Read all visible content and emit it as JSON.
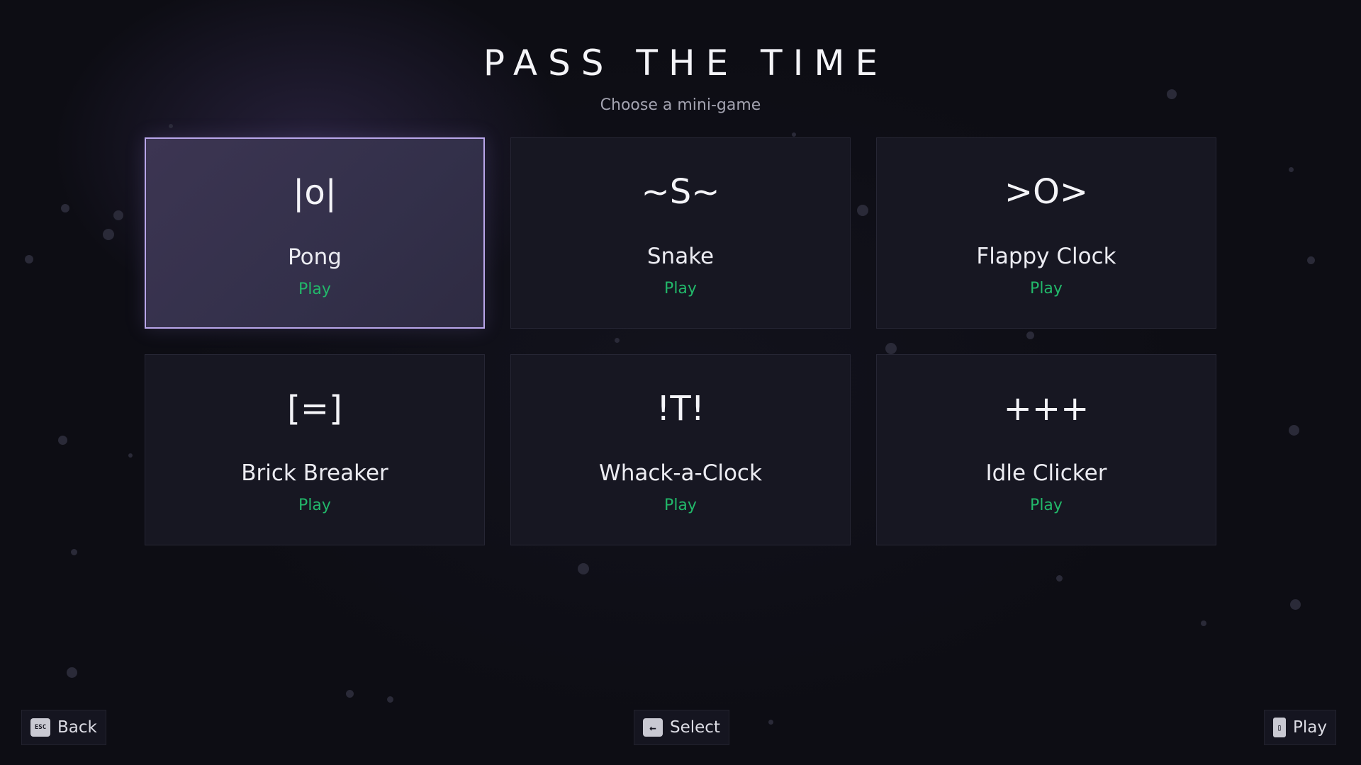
{
  "header": {
    "title": "PASS THE TIME",
    "subtitle": "Choose a mini-game"
  },
  "games": [
    {
      "icon": "|o|",
      "name": "Pong",
      "action": "Play",
      "selected": true
    },
    {
      "icon": "~S~",
      "name": "Snake",
      "action": "Play",
      "selected": false
    },
    {
      "icon": ">O>",
      "name": "Flappy Clock",
      "action": "Play",
      "selected": false
    },
    {
      "icon": "[=]",
      "name": "Brick Breaker",
      "action": "Play",
      "selected": false
    },
    {
      "icon": "!T!",
      "name": "Whack-a-Clock",
      "action": "Play",
      "selected": false
    },
    {
      "icon": "+++",
      "name": "Idle Clicker",
      "action": "Play",
      "selected": false
    }
  ],
  "footer": {
    "back": {
      "key": "ESC",
      "icon": "esc-key-icon",
      "label": "Back"
    },
    "select": {
      "key": "←",
      "icon": "arrow-key-icon",
      "label": "Select"
    },
    "play": {
      "key": "▯",
      "icon": "phone-key-icon",
      "label": "Play"
    }
  },
  "colors": {
    "accent_play": "#22b86a",
    "selected_border": "#b9a6ea",
    "background": "#0d0d14",
    "card": "#171722"
  }
}
